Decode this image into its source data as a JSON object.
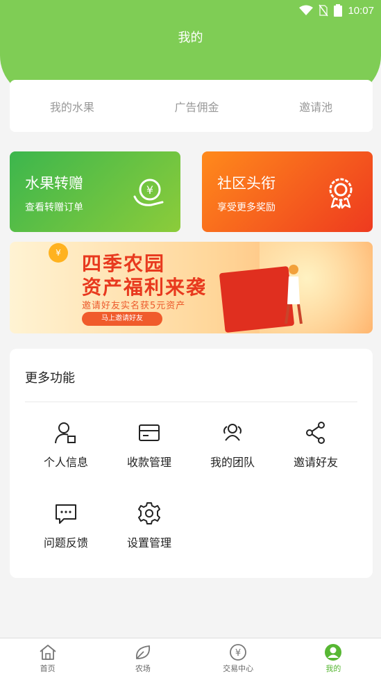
{
  "status_bar": {
    "time": "10:07",
    "icons": [
      "wifi-icon",
      "no-sim-icon",
      "battery-icon"
    ]
  },
  "header": {
    "title": "我的",
    "color": "#7fcd55"
  },
  "top_tabs": [
    {
      "label": "我的水果"
    },
    {
      "label": "广告佣金"
    },
    {
      "label": "邀请池"
    }
  ],
  "cards": {
    "left": {
      "title": "水果转赠",
      "subtitle": "查看转赠订单",
      "icon": "yen-hand-icon"
    },
    "right": {
      "title": "社区头衔",
      "subtitle": "享受更多奖励",
      "icon": "badge-icon"
    }
  },
  "banner": {
    "coin": "¥",
    "line1": "四季农园",
    "line2": "资产福利来袭",
    "subtitle": "邀请好友实名获5元资产",
    "button": "马上邀请好友"
  },
  "more_functions": {
    "title": "更多功能",
    "items": [
      {
        "label": "个人信息",
        "icon": "user-card-icon"
      },
      {
        "label": "收款管理",
        "icon": "card-icon"
      },
      {
        "label": "我的团队",
        "icon": "team-icon"
      },
      {
        "label": "邀请好友",
        "icon": "share-icon"
      },
      {
        "label": "问题反馈",
        "icon": "feedback-icon"
      },
      {
        "label": "设置管理",
        "icon": "gear-icon"
      }
    ]
  },
  "tabbar": {
    "items": [
      {
        "label": "首页",
        "icon": "home-icon"
      },
      {
        "label": "农场",
        "icon": "leaf-icon"
      },
      {
        "label": "交易中心",
        "icon": "yen-circle-icon"
      },
      {
        "label": "我的",
        "icon": "profile-icon"
      }
    ],
    "active_index": 3,
    "active_color": "#57b733"
  }
}
